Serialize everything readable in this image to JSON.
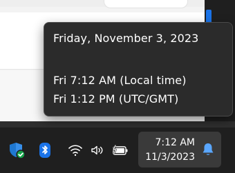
{
  "tooltip": {
    "date_long": "Friday, November 3, 2023",
    "local_time": "Fri 7:12 AM (Local time)",
    "utc_time": "Fri 1:12 PM (UTC/GMT)"
  },
  "clock": {
    "time": "7:12 AM",
    "date": "11/3/2023"
  },
  "tray_icons": [
    "security-shield-icon",
    "bluetooth-icon",
    "wifi-icon",
    "volume-icon",
    "battery-charging-icon",
    "notification-bell-icon"
  ],
  "colors": {
    "accent_blue": "#1a73e8",
    "taskbar_bg": "#1f1f1f",
    "tooltip_bg": "#2b2b2b",
    "bell_blue": "#5aa7ff"
  }
}
